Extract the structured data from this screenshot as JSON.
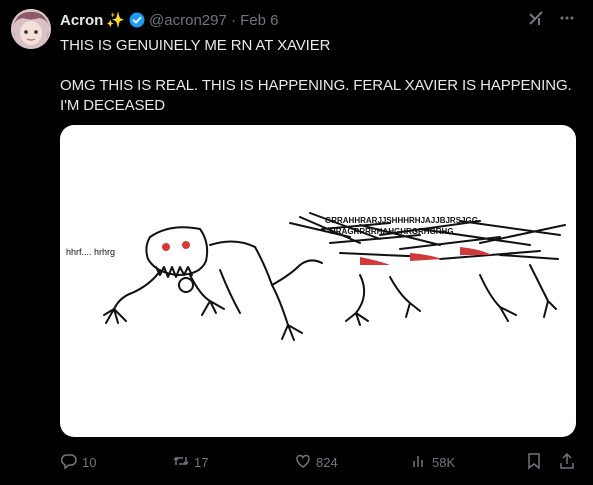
{
  "tweet": {
    "author_name": "Acron",
    "sparkle": "✨",
    "handle_and_date": "@acron297 · Feb 6",
    "text": "THIS IS GENUINELY ME RN AT XAVIER\n\nOMG THIS IS REAL. THIS IS HAPPENING. FERAL XAVIER IS HAPPENING. I'M DECEASED"
  },
  "media": {
    "left_caption": "hhrf.... hrhrg",
    "right_caption_line1": "GRRAHHRARJJSHHHRHJAJJBJRSJGG",
    "right_caption_line2": "HRAGRRRRHAHGHRGRHGRHG"
  },
  "actions": {
    "replies": "10",
    "reposts": "17",
    "likes": "824",
    "views": "58K"
  },
  "icons": {
    "reply": "reply-icon",
    "repost": "repost-icon",
    "like": "heart-icon",
    "views": "views-icon",
    "bookmark": "bookmark-icon",
    "share": "share-icon",
    "grok": "grok-icon",
    "more": "more-icon"
  }
}
